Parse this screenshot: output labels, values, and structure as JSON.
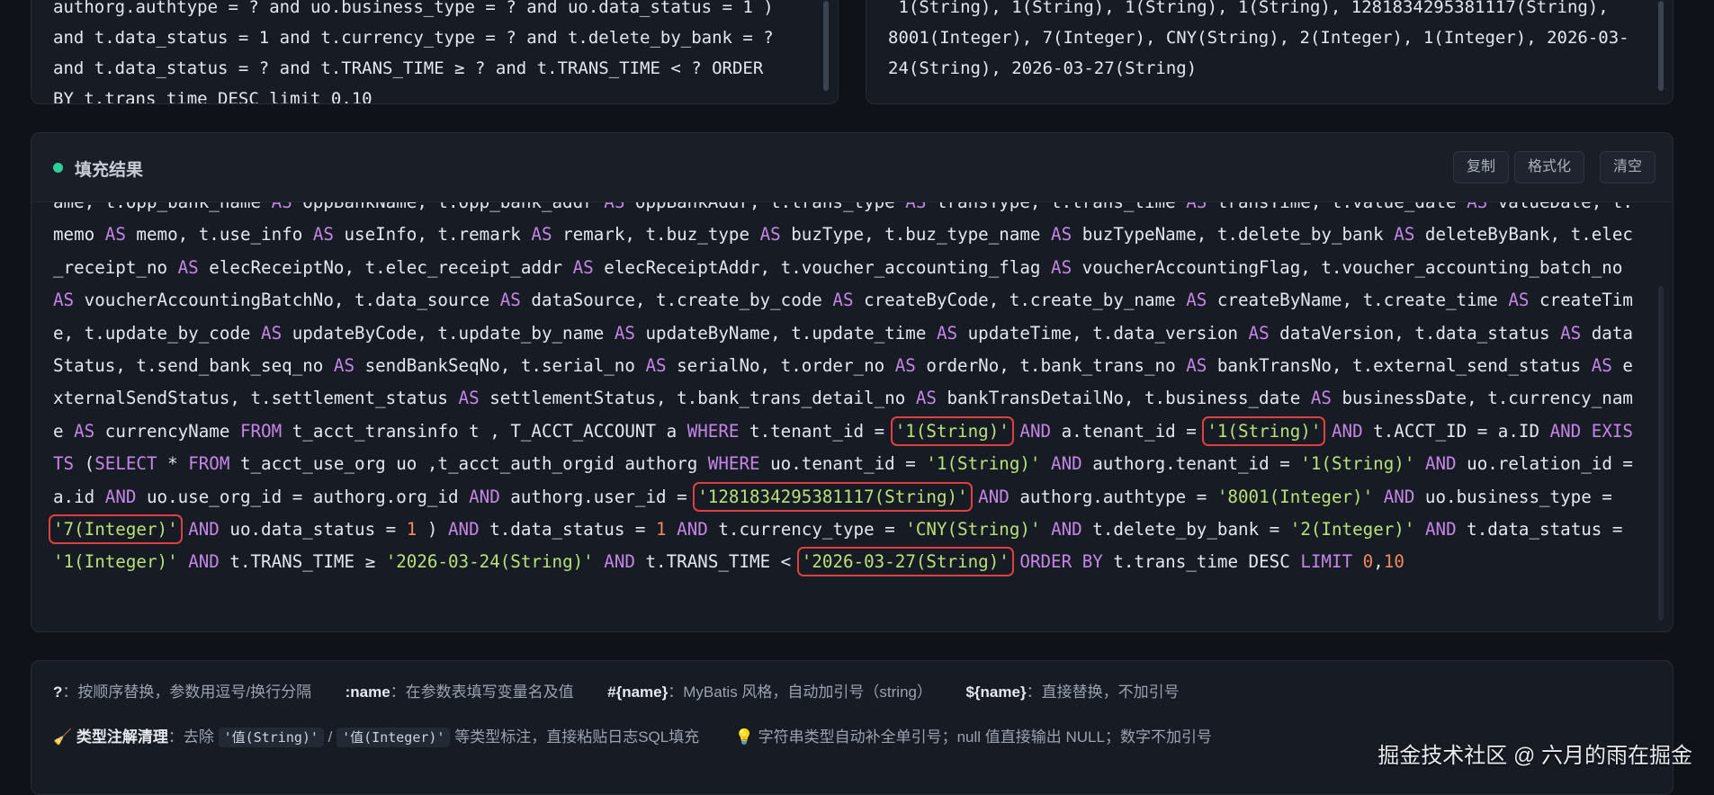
{
  "top_left_sql": "authorg.authtype = ? and uo.business_type = ? and uo.data_status = 1 )\nand t.data_status = 1 and t.currency_type = ? and t.delete_by_bank = ?\nand t.data_status = ? and t.TRANS_TIME ≥ ? and t.TRANS_TIME < ? ORDER\nBY t.trans_time DESC limit 0,10",
  "top_right_params": " 1(String), 1(String), 1(String), 1(String), 1281834295381117(String),\n8001(Integer), 7(Integer), CNY(String), 2(Integer), 1(Integer), 2026-03-\n24(String), 2026-03-27(String)",
  "result": {
    "title": "填充结果",
    "buttons": {
      "copy": "复制",
      "format": "格式化",
      "clear": "清空"
    }
  },
  "sql_tokens": [
    [
      "t",
      "ame, t.opp_bank_name "
    ],
    [
      "k",
      "AS"
    ],
    [
      "t",
      " oppBankName, t.opp_bank_addr "
    ],
    [
      "k",
      "AS"
    ],
    [
      "t",
      " oppBankAddr, t.trans_type "
    ],
    [
      "k",
      "AS"
    ],
    [
      "t",
      " transType, t.trans_time "
    ],
    [
      "k",
      "AS"
    ],
    [
      "t",
      " transTime, t.value_date "
    ],
    [
      "k",
      "AS"
    ],
    [
      "t",
      " valueDate, t.memo "
    ],
    [
      "k",
      "AS"
    ],
    [
      "t",
      " memo, t.use_info "
    ],
    [
      "k",
      "AS"
    ],
    [
      "t",
      " useInfo, t.remark "
    ],
    [
      "k",
      "AS"
    ],
    [
      "t",
      " remark, t.buz_type "
    ],
    [
      "k",
      "AS"
    ],
    [
      "t",
      " buzType, t.buz_type_name "
    ],
    [
      "k",
      "AS"
    ],
    [
      "t",
      " buzTypeName, t.delete_by_bank "
    ],
    [
      "k",
      "AS"
    ],
    [
      "t",
      " deleteByBank, t.elec_receipt_no "
    ],
    [
      "k",
      "AS"
    ],
    [
      "t",
      " elecReceiptNo, t.elec_receipt_addr "
    ],
    [
      "k",
      "AS"
    ],
    [
      "t",
      " elecReceiptAddr, t.voucher_accounting_flag "
    ],
    [
      "k",
      "AS"
    ],
    [
      "t",
      " voucherAccountingFlag, t.voucher_accounting_batch_no "
    ],
    [
      "k",
      "AS"
    ],
    [
      "t",
      " voucherAccountingBatchNo, t.data_source "
    ],
    [
      "k",
      "AS"
    ],
    [
      "t",
      " dataSource, t.create_by_code "
    ],
    [
      "k",
      "AS"
    ],
    [
      "t",
      " createByCode, t.create_by_name "
    ],
    [
      "k",
      "AS"
    ],
    [
      "t",
      " createByName, t.create_time "
    ],
    [
      "k",
      "AS"
    ],
    [
      "t",
      " createTime, t.update_by_code "
    ],
    [
      "k",
      "AS"
    ],
    [
      "t",
      " updateByCode, t.update_by_name "
    ],
    [
      "k",
      "AS"
    ],
    [
      "t",
      " updateByName, t.update_time "
    ],
    [
      "k",
      "AS"
    ],
    [
      "t",
      " updateTime, t.data_version "
    ],
    [
      "k",
      "AS"
    ],
    [
      "t",
      " dataVersion, t.data_status "
    ],
    [
      "k",
      "AS"
    ],
    [
      "t",
      " dataStatus, t.send_bank_seq_no "
    ],
    [
      "k",
      "AS"
    ],
    [
      "t",
      " sendBankSeqNo, t.serial_no "
    ],
    [
      "k",
      "AS"
    ],
    [
      "t",
      " serialNo, t.order_no "
    ],
    [
      "k",
      "AS"
    ],
    [
      "t",
      " orderNo, t.bank_trans_no "
    ],
    [
      "k",
      "AS"
    ],
    [
      "t",
      " bankTransNo, t.external_send_status "
    ],
    [
      "k",
      "AS"
    ],
    [
      "t",
      " externalSendStatus, t.settlement_status "
    ],
    [
      "k",
      "AS"
    ],
    [
      "t",
      " settlementStatus, t.bank_trans_detail_no "
    ],
    [
      "k",
      "AS"
    ],
    [
      "t",
      " bankTransDetailNo, t.business_date "
    ],
    [
      "k",
      "AS"
    ],
    [
      "t",
      " businessDate, t.currency_name "
    ],
    [
      "k",
      "AS"
    ],
    [
      "t",
      " currencyName "
    ],
    [
      "k",
      "FROM"
    ],
    [
      "t",
      " t_acct_transinfo t , T_ACCT_ACCOUNT a "
    ],
    [
      "k",
      "WHERE"
    ],
    [
      "t",
      " t.tenant_id = "
    ],
    [
      "h",
      "'1(String)'"
    ],
    [
      "t",
      " "
    ],
    [
      "k",
      "AND"
    ],
    [
      "t",
      " a.tenant_id = "
    ],
    [
      "h",
      "'1(String)'"
    ],
    [
      "t",
      " "
    ],
    [
      "k",
      "AND"
    ],
    [
      "t",
      " t.ACCT_ID = a.ID "
    ],
    [
      "k",
      "AND EXISTS"
    ],
    [
      "t",
      " ("
    ],
    [
      "k",
      "SELECT"
    ],
    [
      "t",
      " * "
    ],
    [
      "k",
      "FROM"
    ],
    [
      "t",
      " t_acct_use_org uo ,t_acct_auth_orgid authorg "
    ],
    [
      "k",
      "WHERE"
    ],
    [
      "t",
      " uo.tenant_id = "
    ],
    [
      "s",
      "'1(String)'"
    ],
    [
      "t",
      " "
    ],
    [
      "k",
      "AND"
    ],
    [
      "t",
      " authorg.tenant_id = "
    ],
    [
      "s",
      "'1(String)'"
    ],
    [
      "t",
      " "
    ],
    [
      "k",
      "AND"
    ],
    [
      "t",
      " uo.relation_id = a.id "
    ],
    [
      "k",
      "AND"
    ],
    [
      "t",
      " uo.use_org_id = authorg.org_id "
    ],
    [
      "k",
      "AND"
    ],
    [
      "t",
      " authorg.user_id = "
    ],
    [
      "h",
      "'1281834295381117(String)'"
    ],
    [
      "t",
      " "
    ],
    [
      "k",
      "AND"
    ],
    [
      "t",
      " authorg.authtype = "
    ],
    [
      "s",
      "'8001(Integer)'"
    ],
    [
      "t",
      " "
    ],
    [
      "k",
      "AND"
    ],
    [
      "t",
      " uo.business_type = "
    ],
    [
      "h",
      "'7(Integer)'"
    ],
    [
      "t",
      " "
    ],
    [
      "k",
      "AND"
    ],
    [
      "t",
      " uo.data_status = "
    ],
    [
      "n",
      "1"
    ],
    [
      "t",
      " ) "
    ],
    [
      "k",
      "AND"
    ],
    [
      "t",
      " t.data_status = "
    ],
    [
      "n",
      "1"
    ],
    [
      "t",
      " "
    ],
    [
      "k",
      "AND"
    ],
    [
      "t",
      " t.currency_type = "
    ],
    [
      "s",
      "'CNY(String)'"
    ],
    [
      "t",
      " "
    ],
    [
      "k",
      "AND"
    ],
    [
      "t",
      " t.delete_by_bank = "
    ],
    [
      "s",
      "'2(Integer)'"
    ],
    [
      "t",
      " "
    ],
    [
      "k",
      "AND"
    ],
    [
      "t",
      " t.data_status = "
    ],
    [
      "s",
      "'1(Integer)'"
    ],
    [
      "t",
      " "
    ],
    [
      "k",
      "AND"
    ],
    [
      "t",
      " t.TRANS_TIME ≥ "
    ],
    [
      "s",
      "'2026-03-24(String)'"
    ],
    [
      "t",
      " "
    ],
    [
      "k",
      "AND"
    ],
    [
      "t",
      " t.TRANS_TIME < "
    ],
    [
      "h",
      "'2026-03-27(String)'"
    ],
    [
      "t",
      " "
    ],
    [
      "k",
      "ORDER BY"
    ],
    [
      "t",
      " t.trans_time DESC "
    ],
    [
      "k",
      "LIMIT"
    ],
    [
      "t",
      " "
    ],
    [
      "n",
      "0"
    ],
    [
      "t",
      ","
    ],
    [
      "n",
      "10"
    ]
  ],
  "help": {
    "q_key": "?",
    "q_text": "：按顺序替换，参数用逗号/换行分隔",
    "name_key": ":name",
    "name_text": "：在参数表填写变量名及值",
    "mybatis_key": "#{name}",
    "mybatis_text": "：MyBatis 风格，自动加引号（string）",
    "dollar_key": "${name}",
    "dollar_text": "：直接替换，不加引号",
    "clean_title": "类型注解清理",
    "clean_text_1": "：去除 ",
    "tag1": "'值(String)'",
    "sep": " / ",
    "tag2": "'值(Integer)'",
    "clean_text_2": " 等类型标注，直接粘贴日志SQL填充",
    "tip_text": "字符串类型自动补全单引号；null 值直接输出 NULL；数字不加引号",
    "broom_icon": "broom-icon",
    "bulb_icon": "lightbulb-icon"
  },
  "watermark": "掘金技术社区 @ 六月的雨在掘金"
}
